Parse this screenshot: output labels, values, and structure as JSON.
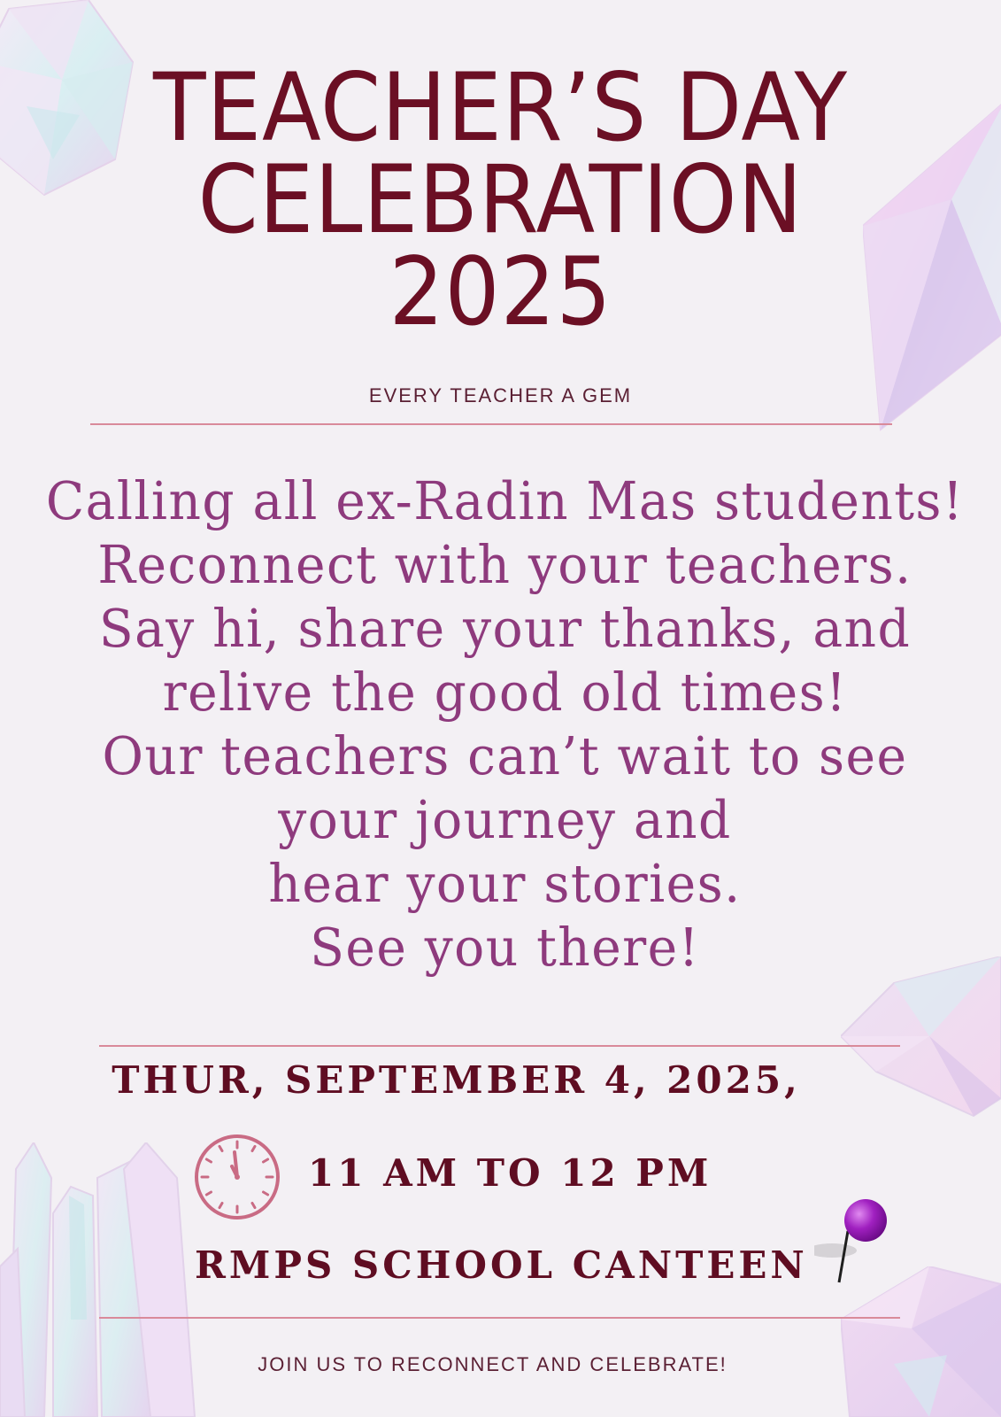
{
  "poster": {
    "title_lines": [
      "TEACHER’S DAY",
      "CELEBRATION",
      "2025"
    ],
    "tagline": "EVERY TEACHER A GEM",
    "message_lines": [
      "Calling all ex-Radin Mas students!",
      "Reconnect with your teachers.",
      "Say hi, share your thanks, and",
      "relive the good old times!",
      "Our teachers can’t wait to see",
      "your journey and",
      "hear your stories.",
      "See you there!"
    ],
    "date": "THUR, SEPTEMBER 4, 2025,",
    "time": "11 AM TO 12 PM",
    "venue": "RMPS SCHOOL CANTEEN",
    "footer": "JOIN US TO RECONNECT AND CELEBRATE!"
  },
  "icons": {
    "clock": "clock-icon",
    "pin": "map-pin-icon",
    "decor": "crystal-gem-icon"
  },
  "colors": {
    "background": "#f3f0f4",
    "title": "#6b0f24",
    "message": "#8e3a7d",
    "details": "#5f0d22",
    "rule": "#d98a9a",
    "pin_head": "#a020c0"
  }
}
